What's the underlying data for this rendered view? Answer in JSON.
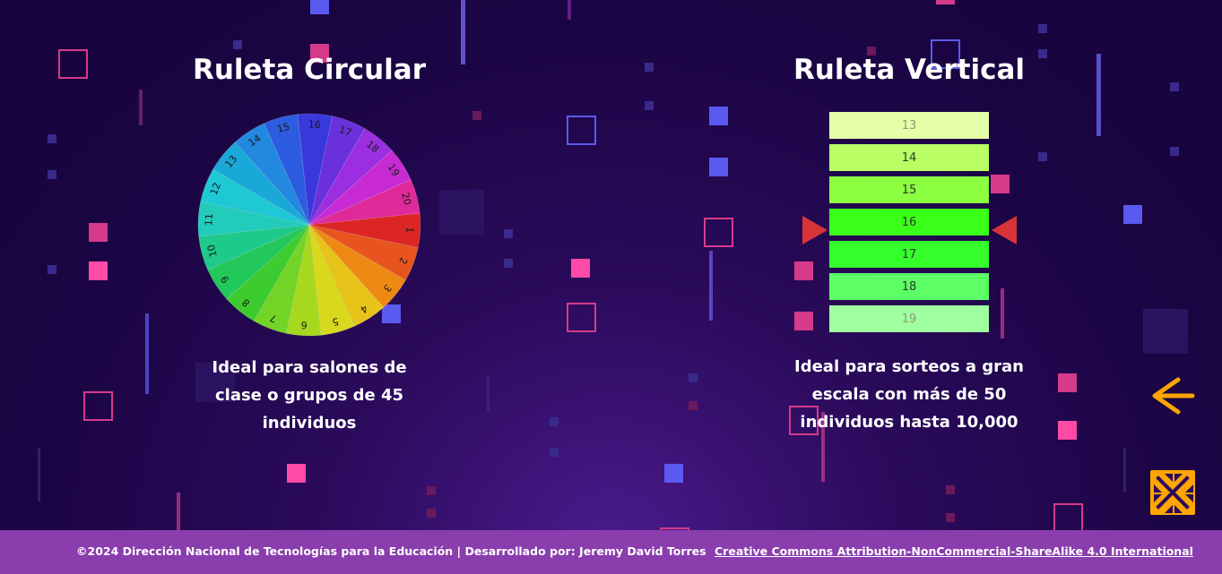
{
  "circular": {
    "title": "Ruleta Circular",
    "description": "Ideal para salones de clase o grupos de 45 individuos",
    "wheel_numbers": [
      "1",
      "2",
      "3",
      "4",
      "5",
      "6",
      "7",
      "8",
      "9",
      "10",
      "11",
      "12",
      "13",
      "14",
      "15",
      "16",
      "17",
      "18",
      "19",
      "20"
    ],
    "wheel_colors": [
      "#dc2626",
      "#e8541e",
      "#ee8a14",
      "#e6c41a",
      "#d8d81c",
      "#a6d81e",
      "#72d426",
      "#3ccc30",
      "#22c85a",
      "#1ec98c",
      "#22ccbb",
      "#1ec8d4",
      "#1aa8d8",
      "#2288e0",
      "#2c5ce0",
      "#3838dc",
      "#6a30dc",
      "#9a2ee0",
      "#c82ad4",
      "#e02a9a",
      "#e02a5c"
    ]
  },
  "vertical": {
    "title": "Ruleta Vertical",
    "description": "Ideal para sorteos a gran escala con más de 50 individuos hasta 10,000",
    "slots": [
      {
        "label": "13",
        "color": "#e4ffa8"
      },
      {
        "label": "14",
        "color": "#b9ff64"
      },
      {
        "label": "15",
        "color": "#8cff40"
      },
      {
        "label": "16",
        "color": "#3aff18"
      },
      {
        "label": "17",
        "color": "#34ff2a"
      },
      {
        "label": "18",
        "color": "#5cff66"
      },
      {
        "label": "19",
        "color": "#a0ff9e"
      }
    ],
    "pointer_color": "#d9333a"
  },
  "footer": {
    "copyright": "©2024 Dirección Nacional de Tecnologías para la Educación | Desarrollado por: Jeremy David Torres",
    "license": "Creative Commons Attribution-NonCommercial-ShareAlike 4.0 International"
  },
  "buttons": {
    "back_icon": "arrow-left-icon",
    "fullscreen_icon": "expand-icon",
    "accent": "#ffa500"
  }
}
